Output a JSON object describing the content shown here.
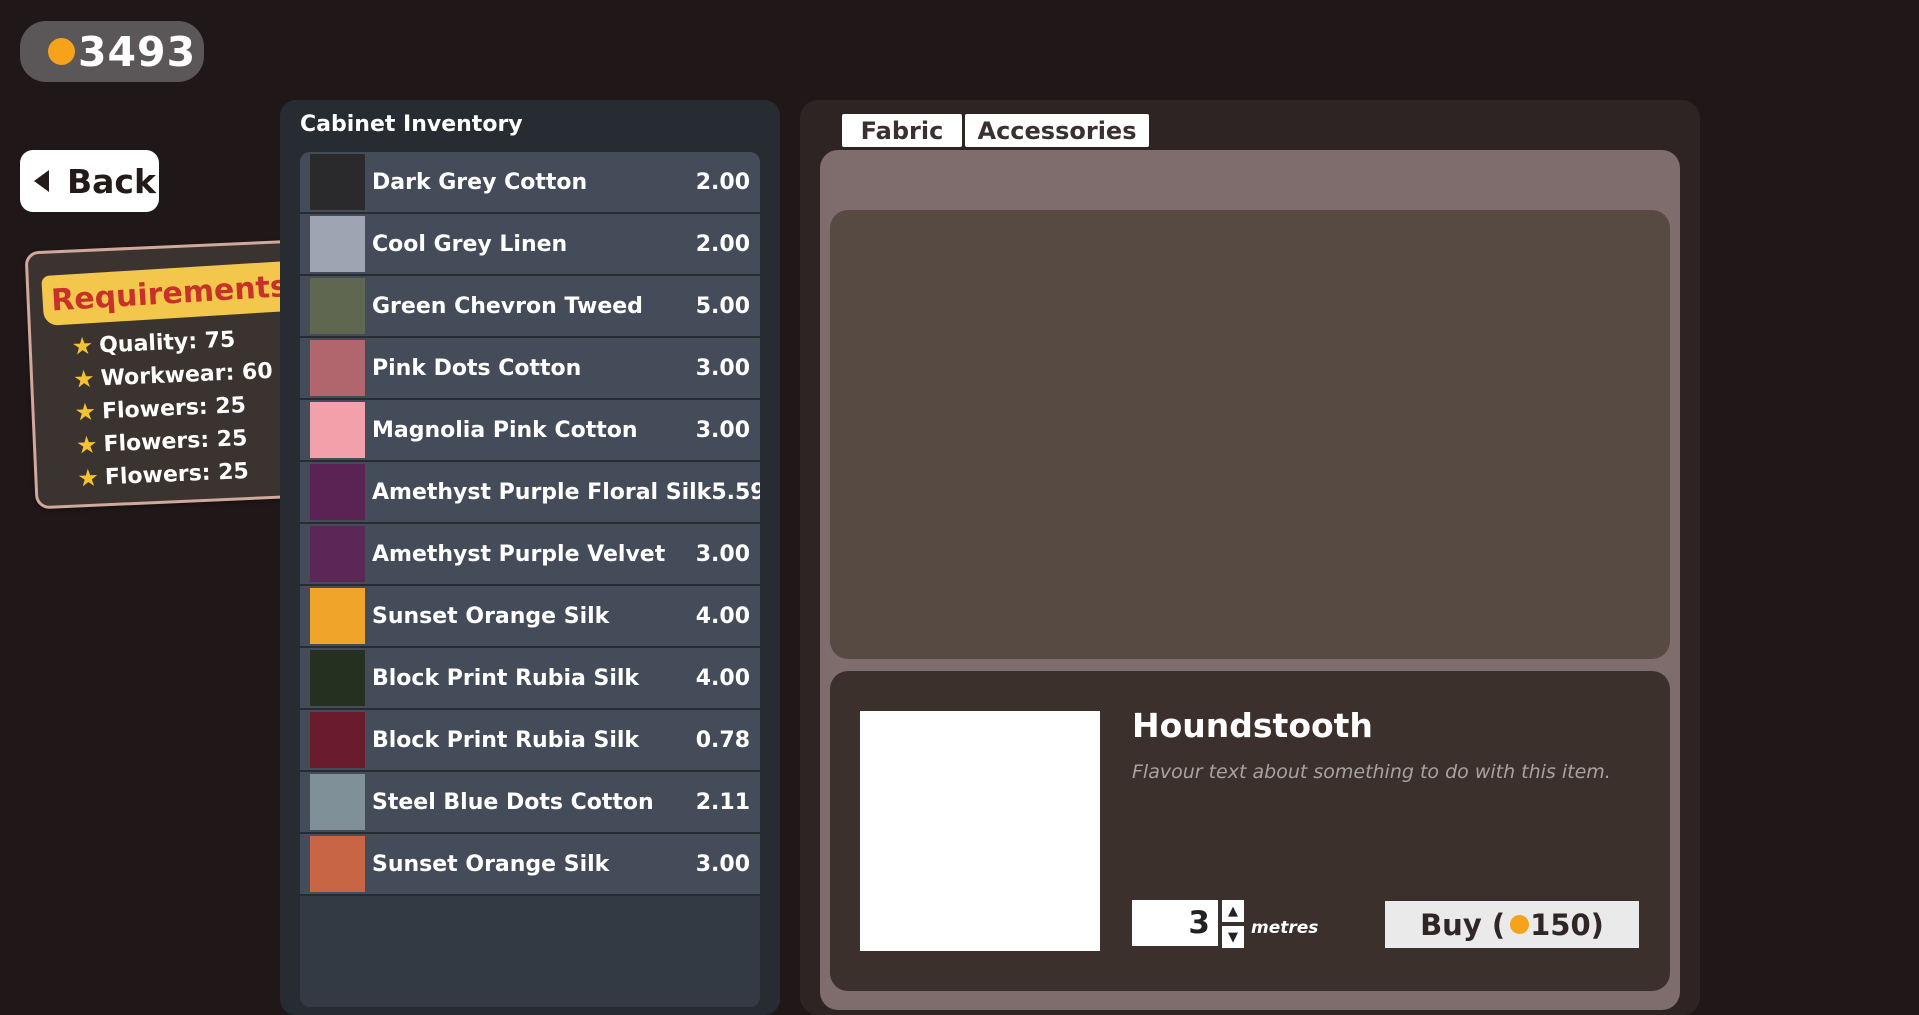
{
  "currency": {
    "amount": "3493",
    "coin_color": "#f7a21b"
  },
  "back_button": {
    "label": "Back"
  },
  "requirements": {
    "title": "Requirements",
    "items": [
      "Quality: 75",
      "Workwear: 60",
      "Flowers: 25",
      "Flowers: 25",
      "Flowers: 25"
    ]
  },
  "inventory": {
    "title": "Cabinet Inventory",
    "items": [
      {
        "name": "Dark Grey Cotton",
        "qty": "2.00",
        "color": "#2a2a2c"
      },
      {
        "name": "Cool Grey Linen",
        "qty": "2.00",
        "color": "#9ea4b2"
      },
      {
        "name": "Green Chevron Tweed",
        "qty": "5.00",
        "color": "#5f6751"
      },
      {
        "name": "Pink Dots Cotton",
        "qty": "3.00",
        "color": "#b0666c"
      },
      {
        "name": "Magnolia Pink Cotton",
        "qty": "3.00",
        "color": "#f2a1aa"
      },
      {
        "name": "Amethyst Purple Floral Silk",
        "qty": "5.59",
        "color": "#5b2354"
      },
      {
        "name": "Amethyst Purple Velvet",
        "qty": "3.00",
        "color": "#5b2757"
      },
      {
        "name": "Sunset Orange Silk",
        "qty": "4.00",
        "color": "#f0a52a"
      },
      {
        "name": "Block Print Rubia Silk",
        "qty": "4.00",
        "color": "#253020"
      },
      {
        "name": "Block Print Rubia Silk",
        "qty": "0.78",
        "color": "#6a1c2c"
      },
      {
        "name": "Steel Blue Dots Cotton",
        "qty": "2.11",
        "color": "#7f9098"
      },
      {
        "name": "Sunset Orange Silk",
        "qty": "3.00",
        "color": "#c86545"
      }
    ]
  },
  "shop": {
    "tabs": [
      "Fabric",
      "Accessories"
    ],
    "active_tab": "Fabric",
    "selected_item": {
      "title": "Houndstooth",
      "flavour": "Flavour text about something to do with this item.",
      "quantity": "3",
      "unit": "metres",
      "buy_label": "Buy (",
      "price": "150",
      "buy_suffix": ")"
    }
  }
}
